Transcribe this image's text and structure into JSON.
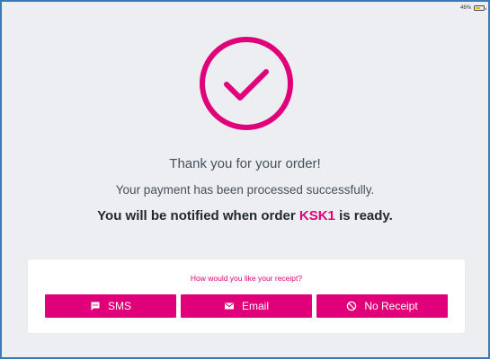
{
  "status_bar": {
    "battery_text": "46%",
    "battery_level": 0.46
  },
  "confirmation": {
    "thank_you": "Thank you for your order!",
    "processed": "Your payment has been processed successfully.",
    "notify_prefix": "You will be notified when order ",
    "order_code": "KSK1",
    "notify_suffix": " is ready."
  },
  "receipt": {
    "question": "How would you like your receipt?",
    "buttons": {
      "sms": {
        "label": "SMS",
        "icon": "sms-icon"
      },
      "email": {
        "label": "Email",
        "icon": "email-icon"
      },
      "none": {
        "label": "No Receipt",
        "icon": "no-receipt-icon"
      }
    }
  },
  "colors": {
    "accent": "#e0007a",
    "background": "#eceef1",
    "frame_border": "#3f78b8"
  }
}
